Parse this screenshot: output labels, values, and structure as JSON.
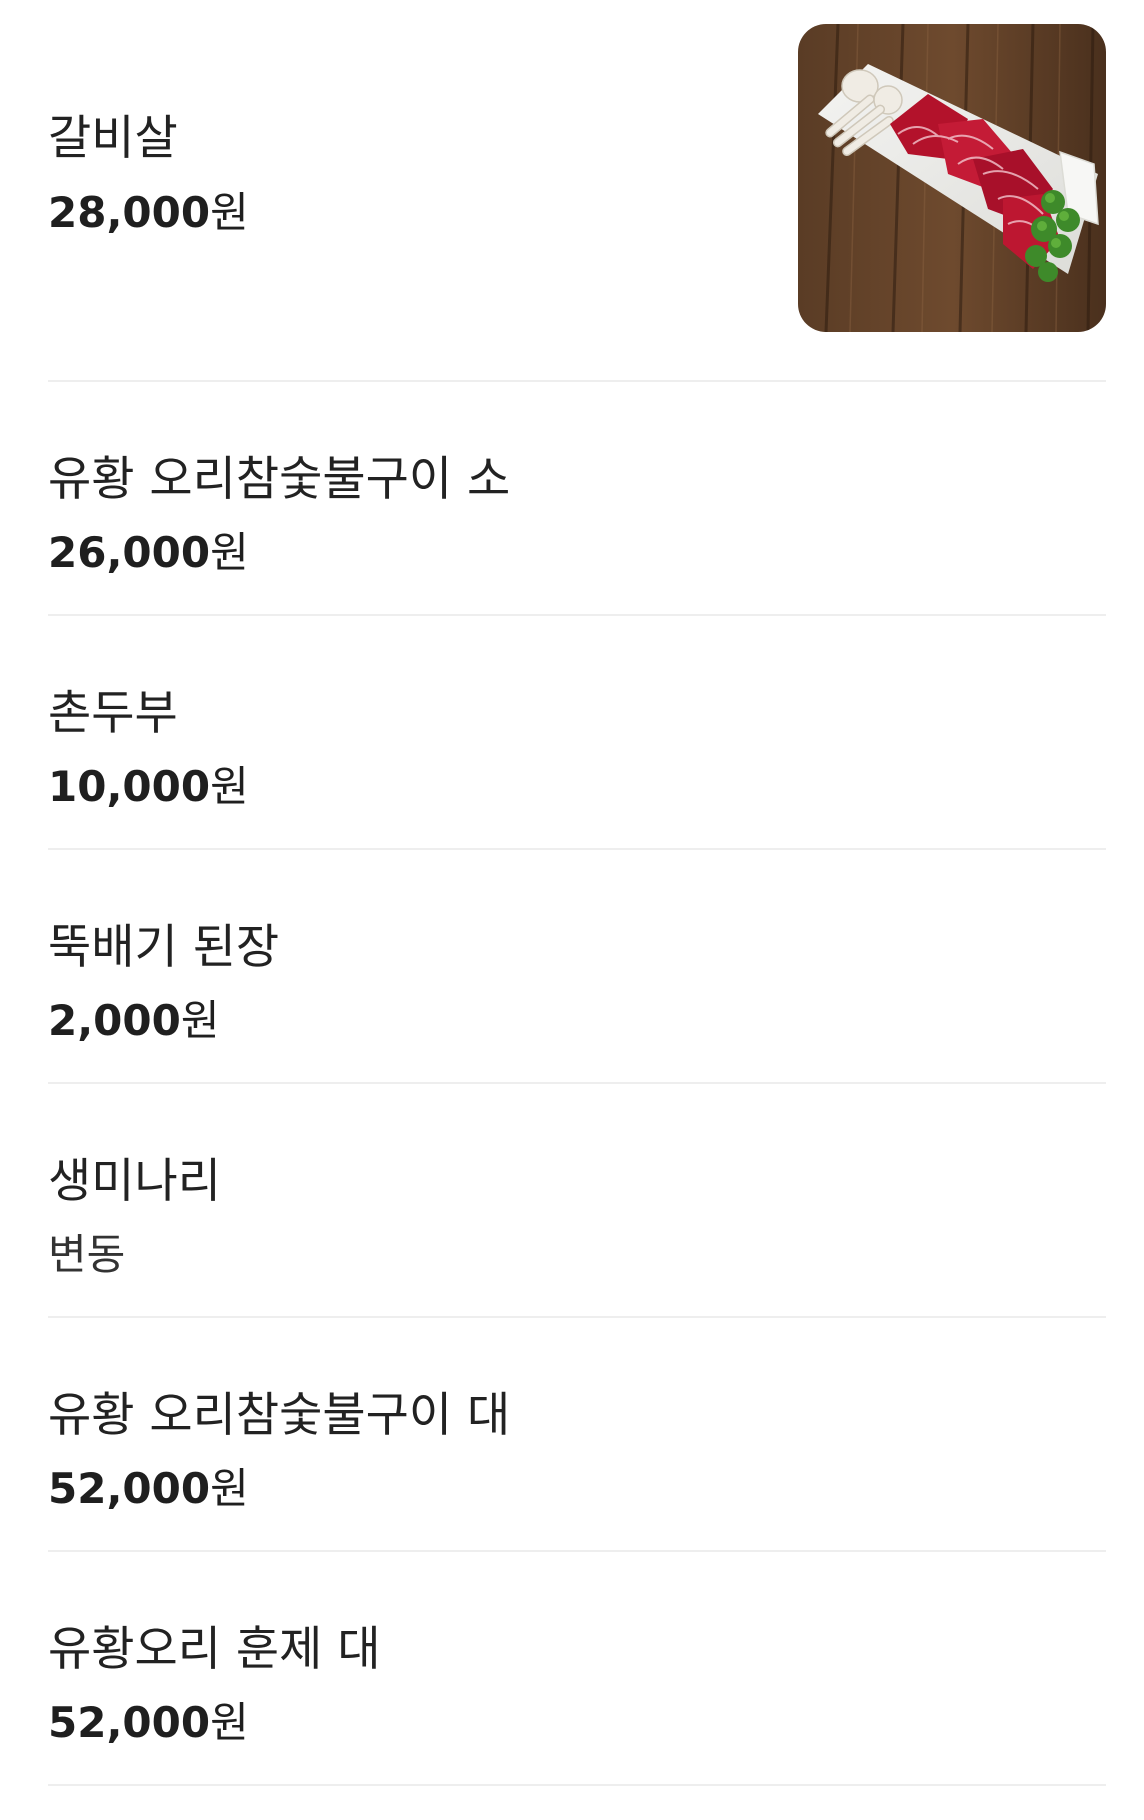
{
  "menu": {
    "currency_unit": "원",
    "items": [
      {
        "name": "갈비살",
        "price": "28,000",
        "has_image": true,
        "image_alt": "beef rib meat platter photo"
      },
      {
        "name": "유황 오리참숯불구이 소",
        "price": "26,000"
      },
      {
        "name": "촌두부",
        "price": "10,000"
      },
      {
        "name": "뚝배기 된장",
        "price": "2,000"
      },
      {
        "name": "생미나리",
        "price_text": "변동"
      },
      {
        "name": "유황 오리참숯불구이 대",
        "price": "52,000"
      },
      {
        "name": "유황오리 훈제 대",
        "price": "52,000"
      }
    ]
  },
  "colors": {
    "text_primary": "#222222",
    "divider": "#eeeeee",
    "background": "#ffffff"
  }
}
